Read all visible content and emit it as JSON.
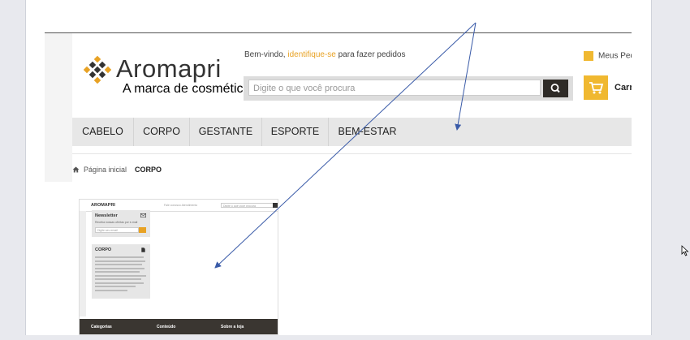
{
  "header": {
    "brand": "Aromapri",
    "tagline": "A marca de cosméticos naturais da família",
    "welcome_prefix": "Bem-vindo, ",
    "welcome_link": "identifique-se",
    "welcome_suffix": " para fazer pedidos",
    "search_placeholder": "Digite o que você procura",
    "my_orders": "Meus Ped",
    "cart": "Carr"
  },
  "nav": {
    "items": [
      "CABELO",
      "CORPO",
      "GESTANTE",
      "ESPORTE",
      "BEM-ESTAR"
    ]
  },
  "breadcrumb": {
    "home": "Página inicial",
    "current": "CORPO"
  },
  "thumbnail": {
    "brand": "AROMAPRI",
    "top_links": "Fale conosco   Atendimento",
    "search_placeholder": "Digite o que você procura",
    "newsletter_title": "Newsletter",
    "newsletter_sub": "Receba nossas ofertas por e-mail",
    "newsletter_input": "Digite seu email",
    "category_title": "CORPO",
    "footer": [
      "Categorias",
      "Conteúdo",
      "Sobre a loja"
    ]
  },
  "colors": {
    "accent": "#f0b830",
    "link": "#e8a224",
    "nav_bg": "#e7e7e7",
    "arrow": "#3a5ba8"
  }
}
